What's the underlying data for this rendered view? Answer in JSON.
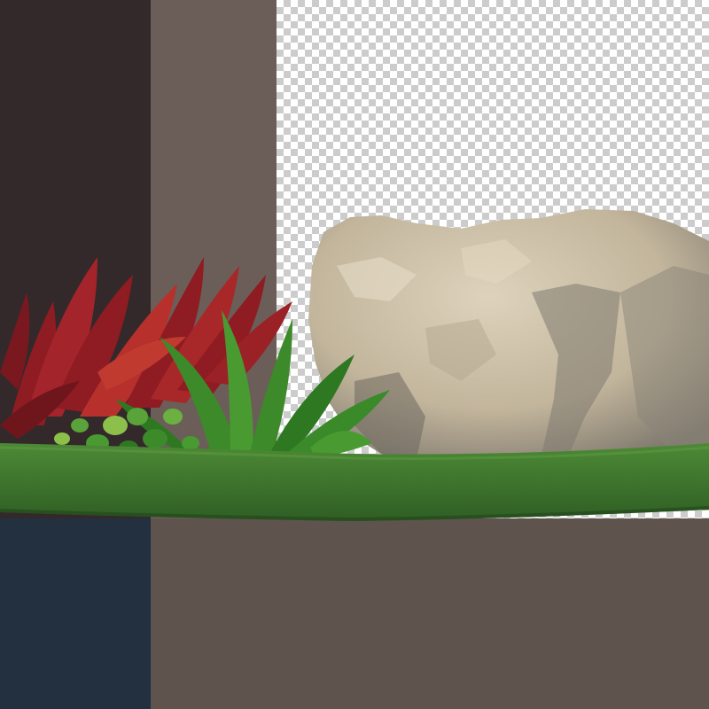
{
  "colors": {
    "dark_brown": "#33292a",
    "taupe": "#6b5e58",
    "navy": "#223040",
    "taupe_bottom": "#5f544d",
    "grass": "#3f7a2f",
    "grass_dark": "#2d5d22",
    "rock": "#c9bca4",
    "rock_shadow": "#8c8476",
    "red_leaf": "#8e1c22",
    "red_leaf_light": "#b8302c",
    "green_leaf": "#3c8a2a",
    "green_leaf_light": "#8cc04a"
  },
  "scene": {
    "subjects": [
      "grass-mat-icon",
      "boulder-icon",
      "red-leaf-shrub-icon",
      "green-fern-icon"
    ],
    "background": "transparency-checkerboard"
  }
}
